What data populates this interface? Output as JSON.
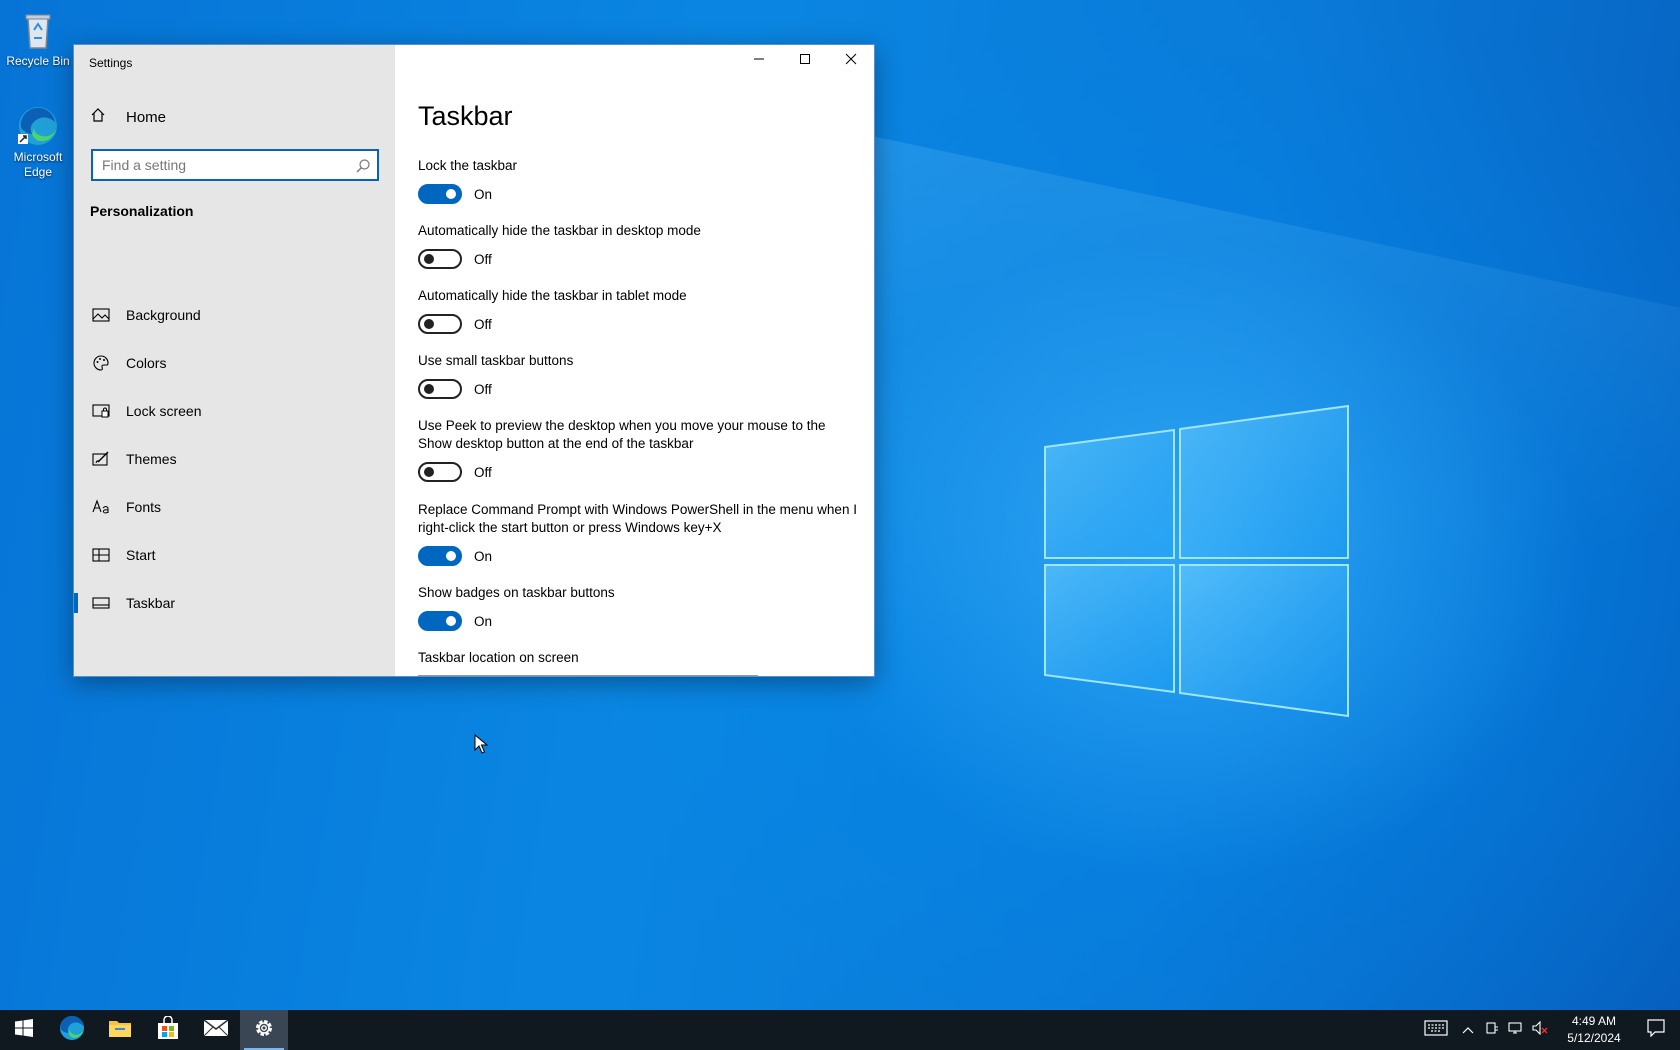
{
  "desktop": {
    "icons": [
      {
        "label": "Recycle Bin",
        "icon": "recycle-bin-icon"
      },
      {
        "label": "Microsoft Edge",
        "icon": "edge-icon"
      }
    ]
  },
  "window": {
    "title": "Settings",
    "sidebar": {
      "home_label": "Home",
      "search_placeholder": "Find a setting",
      "section_title": "Personalization",
      "items": [
        {
          "label": "Background",
          "icon": "picture-icon"
        },
        {
          "label": "Colors",
          "icon": "palette-icon"
        },
        {
          "label": "Lock screen",
          "icon": "lock-screen-icon"
        },
        {
          "label": "Themes",
          "icon": "themes-icon"
        },
        {
          "label": "Fonts",
          "icon": "fonts-icon"
        },
        {
          "label": "Start",
          "icon": "start-icon"
        },
        {
          "label": "Taskbar",
          "icon": "taskbar-icon",
          "active": true
        }
      ]
    },
    "content": {
      "page_title": "Taskbar",
      "settings": [
        {
          "label": "Lock the taskbar",
          "state": "On"
        },
        {
          "label": "Automatically hide the taskbar in desktop mode",
          "state": "Off"
        },
        {
          "label": "Automatically hide the taskbar in tablet mode",
          "state": "Off"
        },
        {
          "label": "Use small taskbar buttons",
          "state": "Off"
        },
        {
          "label": "Use Peek to preview the desktop when you move your mouse to the Show desktop button at the end of the taskbar",
          "state": "Off"
        },
        {
          "label": "Replace Command Prompt with Windows PowerShell in the menu when I right-click the start button or press Windows key+X",
          "state": "On"
        },
        {
          "label": "Show badges on taskbar buttons",
          "state": "On"
        }
      ],
      "location_label": "Taskbar location on screen"
    }
  },
  "taskbar": {
    "apps": [
      "start-icon",
      "edge-icon",
      "file-explorer-icon",
      "store-icon",
      "mail-icon",
      "settings-icon"
    ],
    "time": "4:49 AM",
    "date": "5/12/2024"
  },
  "colors": {
    "accent": "#0067c0",
    "desktop": "#0a78d7",
    "taskbar": "#101820"
  }
}
